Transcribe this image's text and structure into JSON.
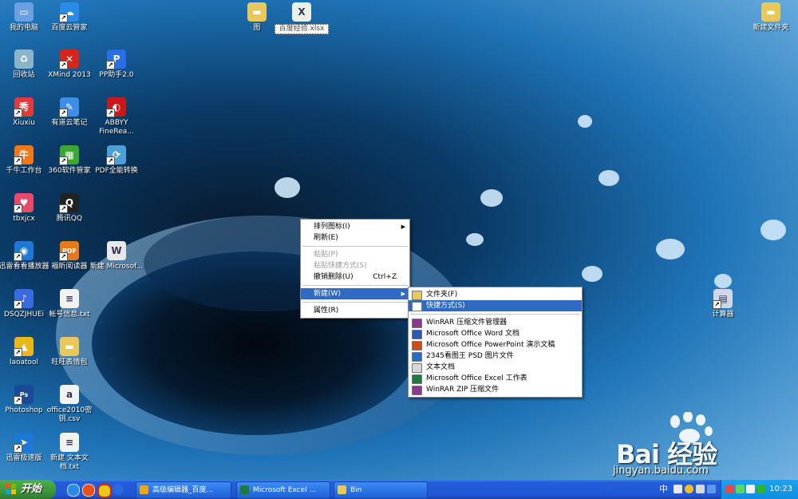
{
  "desktop": {
    "icons": [
      {
        "label": "我的电脑",
        "color": "#6aa0e0",
        "glyph": "▭",
        "shortcut": false
      },
      {
        "label": "百度云管家",
        "color": "#2a8ae8",
        "glyph": "☁",
        "shortcut": true
      },
      {
        "label": "回收站",
        "color": "#8ab4c8",
        "glyph": "♻",
        "shortcut": false
      },
      {
        "label": "XMind 2013",
        "color": "#d8241c",
        "glyph": "✕",
        "shortcut": true
      },
      {
        "label": "PP助手2.0",
        "color": "#2a6ee6",
        "glyph": "P",
        "shortcut": true
      },
      {
        "label": "Xiuxiu",
        "color": "#e23a3a",
        "glyph": "秀",
        "shortcut": true
      },
      {
        "label": "有道云笔记",
        "color": "#3c8ee8",
        "glyph": "✎",
        "shortcut": true
      },
      {
        "label": "ABBYY FineRea...",
        "color": "#c81818",
        "glyph": "◐",
        "shortcut": true
      },
      {
        "label": "千牛工作台",
        "color": "#f07818",
        "glyph": "牛",
        "shortcut": true
      },
      {
        "label": "360软件管家",
        "color": "#3aa832",
        "glyph": "▦",
        "shortcut": true
      },
      {
        "label": "PDF全能转换",
        "color": "#4ca0d8",
        "glyph": "⟳",
        "shortcut": true
      },
      {
        "label": "tbxjcx",
        "color": "#e84a6a",
        "glyph": "♥",
        "shortcut": true
      },
      {
        "label": "腾讯QQ",
        "color": "#222222",
        "glyph": "Q",
        "shortcut": true
      },
      {
        "label": "迅雷看看播放器",
        "color": "#1c7ad6",
        "glyph": "◉",
        "shortcut": true
      },
      {
        "label": "福昕阅读器",
        "color": "#e87818",
        "glyph": "PDF",
        "shortcut": true
      },
      {
        "label": "新建 Microsof...",
        "color": "#e8e8e8",
        "glyph": "W",
        "shortcut": false
      },
      {
        "label": "DSQZJHUEi",
        "color": "#3a6ae0",
        "glyph": "♪",
        "shortcut": true
      },
      {
        "label": "帐号信息.txt",
        "color": "#f2f2f2",
        "glyph": "≡",
        "shortcut": false
      },
      {
        "label": "laoatool",
        "color": "#e8b818",
        "glyph": "▲",
        "shortcut": true
      },
      {
        "label": "旺旺表情包",
        "color": "#e8c85a",
        "glyph": "▬",
        "shortcut": false
      },
      {
        "label": "Photoshop",
        "color": "#1c4a98",
        "glyph": "Ps",
        "shortcut": true
      },
      {
        "label": "office2010密钥.csv",
        "color": "#f2f2f2",
        "glyph": "a",
        "shortcut": false
      },
      {
        "label": "迅雷极速版",
        "color": "#1c7ad6",
        "glyph": "➤",
        "shortcut": true
      },
      {
        "label": "新建 文本文档.txt",
        "color": "#f2f2f2",
        "glyph": "≡",
        "shortcut": false
      },
      {
        "label": "图",
        "color": "#e8c85a",
        "glyph": "▬",
        "shortcut": false
      },
      {
        "label": "百度经验.xlsx",
        "color": "#e8f0e8",
        "glyph": "X",
        "shortcut": false,
        "selected": true
      },
      {
        "label": "新建文件夹",
        "color": "#e8c85a",
        "glyph": "▬",
        "shortcut": false
      },
      {
        "label": "计算器",
        "color": "#d0d8e8",
        "glyph": "▤",
        "shortcut": true
      }
    ]
  },
  "context_menu": {
    "items": [
      {
        "label": "排列图标(I)",
        "submenu": true
      },
      {
        "label": "刷新(E)"
      },
      {
        "sep": true
      },
      {
        "label": "粘贴(P)",
        "disabled": true
      },
      {
        "label": "粘贴快捷方式(S)",
        "disabled": true
      },
      {
        "label": "撤销删除(U)",
        "shortcut": "Ctrl+Z"
      },
      {
        "sep": true
      },
      {
        "label": "新建(W)",
        "submenu": true,
        "highlighted": true
      },
      {
        "sep": true
      },
      {
        "label": "属性(R)"
      }
    ]
  },
  "new_submenu": {
    "items": [
      {
        "label": "文件夹(F)",
        "icon": "folder-icon",
        "color": "#e8c85a"
      },
      {
        "label": "快捷方式(S)",
        "icon": "shortcut-icon",
        "color": "#ffffff",
        "highlighted": true
      },
      {
        "sep": true
      },
      {
        "label": "WinRAR 压缩文件管理器",
        "icon": "winrar-icon",
        "color": "#8a3a8a"
      },
      {
        "label": "Microsoft Office Word 文档",
        "icon": "word-icon",
        "color": "#2a5ab8"
      },
      {
        "label": "Microsoft Office PowerPoint 演示文稿",
        "icon": "powerpoint-icon",
        "color": "#d04a1a"
      },
      {
        "label": "2345看图王 PSD 图片文件",
        "icon": "psd-icon",
        "color": "#2a6ac8"
      },
      {
        "label": "文本文档",
        "icon": "text-file-icon",
        "color": "#d8d8d8"
      },
      {
        "label": "Microsoft Office Excel 工作表",
        "icon": "excel-icon",
        "color": "#1e7a3a"
      },
      {
        "label": "WinRAR ZIP 压缩文件",
        "icon": "winrar-zip-icon",
        "color": "#8a3a8a"
      }
    ]
  },
  "taskbar": {
    "start_label": "开始",
    "tasks": [
      {
        "label": "高级编辑器_百度...",
        "color": "#e8a818"
      },
      {
        "label": "Microsoft Excel ...",
        "color": "#1e7a3a"
      },
      {
        "label": "Bin",
        "color": "#e8c85a"
      }
    ],
    "ime_label": "中",
    "clock": "10:23"
  },
  "watermark": {
    "brand": "Bai 经验",
    "site": "jingyan.baidu.com"
  }
}
